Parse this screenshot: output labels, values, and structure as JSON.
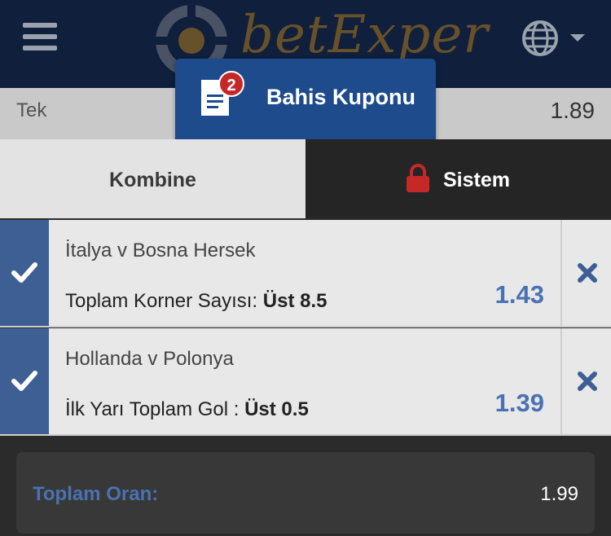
{
  "header": {
    "logo_text": "betExper",
    "menu_icon": "hamburger-icon",
    "language_icon": "globe-icon"
  },
  "tek": {
    "label": "Tek",
    "odds": "1.89"
  },
  "coupon": {
    "label": "Bahis Kuponu",
    "badge_count": "2"
  },
  "tabs": {
    "combine": "Kombine",
    "system": "Sistem"
  },
  "bets": [
    {
      "match": "İtalya v Bosna Hersek",
      "market": "Toplam Korner Sayısı: ",
      "selection": "Üst 8.5",
      "odds": "1.43"
    },
    {
      "match": "Hollanda v Polonya",
      "market": "İlk Yarı Toplam Gol : ",
      "selection": "Üst 0.5",
      "odds": "1.39"
    }
  ],
  "total": {
    "label": "Toplam Oran:",
    "value": "1.99"
  },
  "colors": {
    "header_bg": "#0f1f3c",
    "coupon_bg": "#1d4b8b",
    "check_bg": "#3e5f94",
    "odds": "#4a72b3",
    "badge": "#c62828"
  }
}
